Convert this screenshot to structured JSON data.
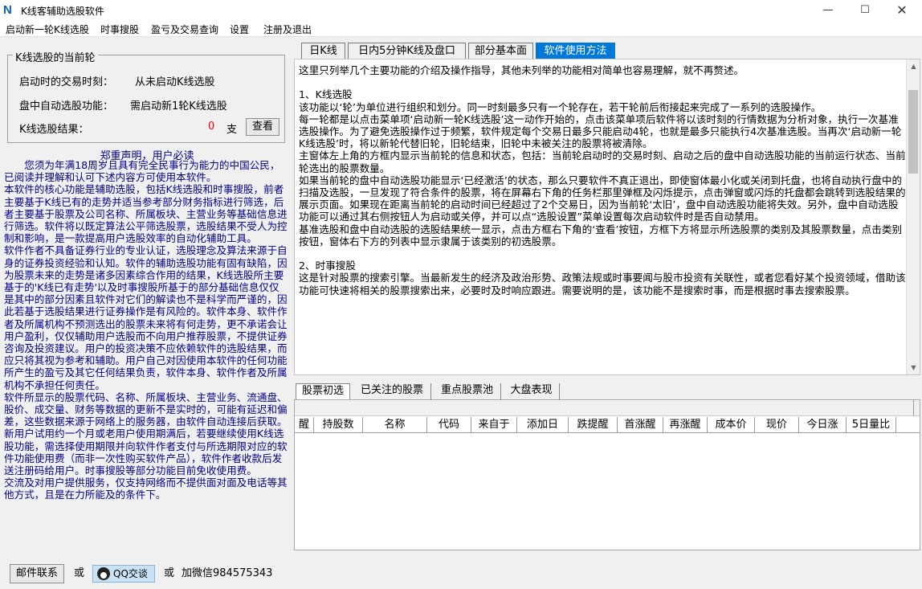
{
  "window": {
    "title": "K线客辅助选股软件",
    "icon_letter": "N",
    "min_icon": "minimize-icon",
    "max_icon": "maximize-icon",
    "close_icon": "close-icon"
  },
  "menu": [
    "启动新一轮K线选股",
    "时事搜股",
    "盈亏及交易查询",
    "设置",
    "注册及退出"
  ],
  "round_group": {
    "title": "K线选股的当前轮",
    "start_time_label": "启动时的交易时刻：",
    "start_time_value": "从未启动K线选股",
    "auto_label": "盘中自动选股功能：",
    "auto_value": "需启动新1轮K线选股",
    "result_label": "K线选股结果：",
    "result_count": "0",
    "result_unit": "支",
    "view_button": "查看",
    "count_color": "#ff0000"
  },
  "disclaimer": {
    "title": "郑重声明，用户必读",
    "text": "您须为年满18周岁且具有完全民事行为能力的中国公民，已阅读并理解和认可下述内容方可使用本软件。\n本软件的核心功能是辅助选股，包括K线选股和时事搜股，前者主要基于K线已有的走势并适当参考部分财务指标进行筛选，后者主要基于股票及公司名称、所属板块、主营业务等基础信息进行筛选。软件将以既定算法公平筛选股票，选股结果不受人为控制和影响，是一款提高用户选股效率的自动化辅助工具。\n软件作者不具备证券行业的专业认证，选股理念及算法来源于自身的证券投资经验和认知。软件的辅助选股功能有固有缺陷，因为股票未来的走势是诸多因素综合作用的结果，K线选股所主要基于的'K线已有走势'以及时事搜股所基于的部分基础信息仅仅是其中的部分因素且软件对它们的解读也不是科学而严谨的，因此若基于选股结果进行证券操作是有风险的。软件本身、软件作者及所属机构不预测选出的股票未来将有何走势，更不承诺会让用户盈利，仅仅辅助用户选股而不向用户推荐股票，不提供证券咨询及投资建议。用户的投资决策不应依赖软件的选股结果，而应只将其视为参考和辅助。用户自己对因使用本软件的任何功能所产生的盈亏及其它任何结果负责，软件本身、软件作者及所属机构不承担任何责任。\n软件所显示的股票代码、名称、所属板块、主营业务、流通盘、股价、成交量、财务等数据的更新不是实时的，可能有延迟和偏差，这些数据来源于网络上的服务器，由软件自动连接后获取。\n新用户试用约一个月或老用户使用期满后，若要继续使用K线选股功能，需选择使用期限并向软件作者支付与所选期限对应的软件功能使用费（而非一次性购买软件产品），软件作者收款后发送注册码给用户。时事搜股等部分功能目前免收使用费。\n交流及对用户提供服务，仅支持网络而不提供面对面及电话等其他方式，且是在力所能及的条件下。"
  },
  "contact": {
    "mail_button": "邮件联系",
    "or1": "或",
    "qq_button": "QQ交谈",
    "qq_icon": "qq-icon",
    "or2": "或",
    "wechat": "加微信984575343"
  },
  "top_tabs": [
    "日K线",
    "日内5分钟K线及盘口",
    "部分基本面",
    "软件使用方法"
  ],
  "top_active": 3,
  "help_text": "这里只列举几个主要功能的介绍及操作指导，其他未列举的功能相对简单也容易理解，就不再赘述。\n\n1、K线选股\n该功能以‘轮’为单位进行组织和划分。同一时刻最多只有一个轮存在，若干轮前后衔接起来完成了一系列的选股操作。\n每一轮都是以点击菜单项‘启动新一轮K线选股’这一动作开始的，点击该菜单项后软件将以该时刻的行情数据为分析对象，执行一次基准选股操作。为了避免选股操作过于频繁，软件规定每个交易日最多只能启动4轮，也就是最多只能执行4次基准选股。当再次‘启动新一轮K线选股’时，将以新轮代替旧轮，旧轮结束，旧轮中未被关注的股票将被清除。\n主窗体左上角的方框内显示当前轮的信息和状态，包括：当前轮启动时的交易时刻、启动之后的盘中自动选股功能的当前运行状态、当前轮选出的股票数量。\n如果当前轮的盘中自动选股功能显示‘已经激活’的状态，那么只要软件不真正退出，即使窗体最小化或关闭到托盘，也将自动执行盘中的扫描及选股，一旦发现了符合条件的股票，将在屏幕右下角的任务栏那里弹框及闪烁提示，点击弹窗或闪烁的托盘都会跳转到选股结果的展示页面。如果现在距离当前轮的启动时间已经超过了2个交易日，因为当前轮‘太旧’，盘中自动选股功能将失效。另外，盘中自动选股功能可以通过其右侧按钮人为启动或关停，并可以点“选股设置”菜单设置每次启动软件时是否自动禁用。\n基准选股和盘中自动选股的选股结果统一显示，点击方框右下角的‘查看’按钮，方框下方将显示所选股票的类别及其股票数量，点击类别按钮，窗体右下方的列表中显示隶属于该类别的初选股票。\n\n2、时事搜股\n这是针对股票的搜索引擎。当最新发生的经济及政治形势、政策法规或时事要闻与股市投资有关联性，或者您看好某个投资领域，借助该功能可快速将相关的股票搜索出来，必要时及时响应跟进。需要说明的是，该功能不是搜索时事，而是根据时事去搜索股票。",
  "bottom_tabs": [
    "股票初选",
    "已关注的股票",
    "重点股票池",
    "大盘表现"
  ],
  "bottom_active": 0,
  "columns": [
    "醒",
    "持股数",
    "名称",
    "代码",
    "来自于",
    "添加日",
    "跌提醒",
    "首涨醒",
    "再涨醒",
    "成本价",
    "现价",
    "今日涨",
    "5日量比"
  ]
}
